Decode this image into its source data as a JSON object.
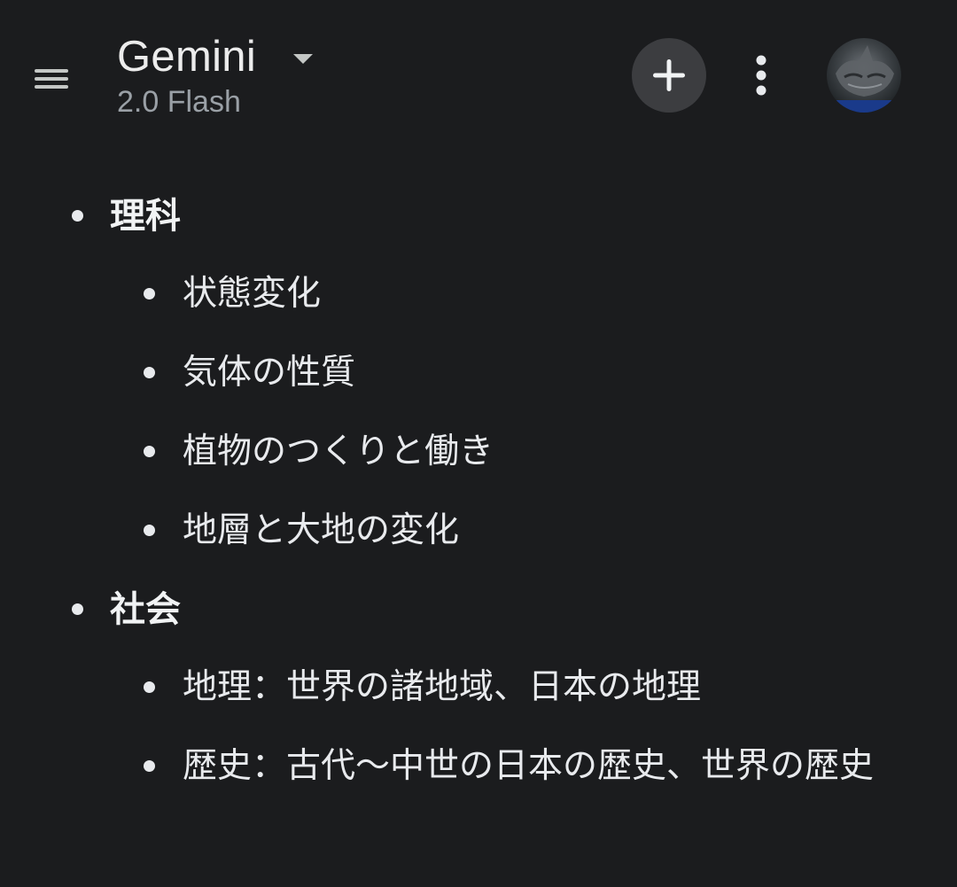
{
  "header": {
    "title": "Gemini",
    "model": "2.0 Flash"
  },
  "icons": {
    "menu": "hamburger-menu-icon",
    "dropdown": "caret-down-icon",
    "new_chat": "plus-icon",
    "more": "vertical-dots-icon",
    "avatar": "user-avatar"
  },
  "sections": [
    {
      "title": "理科",
      "items": [
        "状態変化",
        "気体の性質",
        "植物のつくりと働き",
        "地層と大地の変化"
      ]
    },
    {
      "title": "社会",
      "items": [
        "地理：世界の諸地域、日本の地理",
        "歴史：古代〜中世の日本の歴史、世界の歴史"
      ]
    }
  ]
}
